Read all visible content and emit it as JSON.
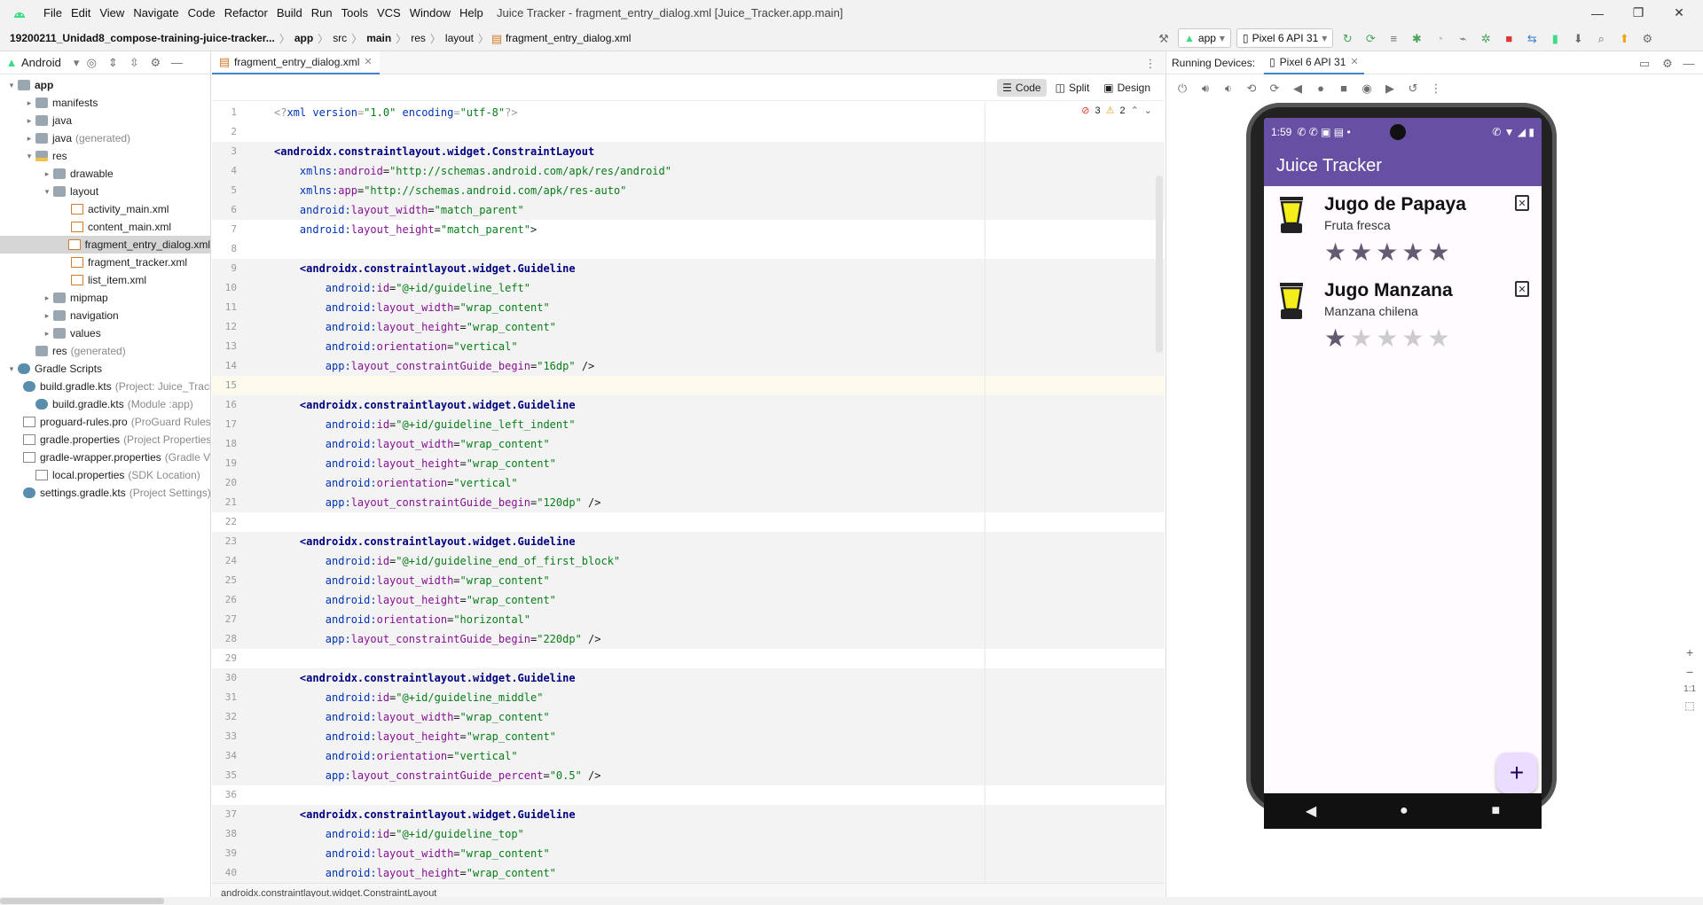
{
  "menu": {
    "items": [
      "File",
      "Edit",
      "View",
      "Navigate",
      "Code",
      "Refactor",
      "Build",
      "Run",
      "Tools",
      "VCS",
      "Window",
      "Help"
    ],
    "window_title": "Juice Tracker - fragment_entry_dialog.xml [Juice_Tracker.app.main]"
  },
  "nav": {
    "project": "19200211_Unidad8_compose-training-juice-tracker...",
    "crumbs": [
      "app",
      "src",
      "main",
      "res",
      "layout"
    ],
    "file": "fragment_entry_dialog.xml",
    "run_config": "app",
    "device": "Pixel 6 API 31"
  },
  "project_panel": {
    "view_mode": "Android",
    "tree": [
      {
        "label": "app",
        "depth": 0,
        "arrow": "▾",
        "icon": "folder",
        "bold": true
      },
      {
        "label": "manifests",
        "depth": 1,
        "arrow": "▸",
        "icon": "folder"
      },
      {
        "label": "java",
        "depth": 1,
        "arrow": "▸",
        "icon": "folder"
      },
      {
        "label": "java",
        "extra": "(generated)",
        "depth": 1,
        "arrow": "▸",
        "icon": "folder"
      },
      {
        "label": "res",
        "depth": 1,
        "arrow": "▾",
        "icon": "resfolder"
      },
      {
        "label": "drawable",
        "depth": 2,
        "arrow": "▸",
        "icon": "folder"
      },
      {
        "label": "layout",
        "depth": 2,
        "arrow": "▾",
        "icon": "folder"
      },
      {
        "label": "activity_main.xml",
        "depth": 3,
        "arrow": "",
        "icon": "xml"
      },
      {
        "label": "content_main.xml",
        "depth": 3,
        "arrow": "",
        "icon": "xml"
      },
      {
        "label": "fragment_entry_dialog.xml",
        "depth": 3,
        "arrow": "",
        "icon": "xml",
        "selected": true
      },
      {
        "label": "fragment_tracker.xml",
        "depth": 3,
        "arrow": "",
        "icon": "xml"
      },
      {
        "label": "list_item.xml",
        "depth": 3,
        "arrow": "",
        "icon": "xml"
      },
      {
        "label": "mipmap",
        "depth": 2,
        "arrow": "▸",
        "icon": "folder"
      },
      {
        "label": "navigation",
        "depth": 2,
        "arrow": "▸",
        "icon": "folder"
      },
      {
        "label": "values",
        "depth": 2,
        "arrow": "▸",
        "icon": "folder"
      },
      {
        "label": "res",
        "extra": "(generated)",
        "depth": 1,
        "arrow": "",
        "icon": "folder"
      },
      {
        "label": "Gradle Scripts",
        "depth": 0,
        "arrow": "▾",
        "icon": "gradle"
      },
      {
        "label": "build.gradle.kts",
        "extra": "(Project: Juice_Tracker)",
        "depth": 1,
        "arrow": "",
        "icon": "gradle"
      },
      {
        "label": "build.gradle.kts",
        "extra": "(Module :app)",
        "depth": 1,
        "arrow": "",
        "icon": "gradle"
      },
      {
        "label": "proguard-rules.pro",
        "extra": "(ProGuard Rules for \":app\")",
        "depth": 1,
        "arrow": "",
        "icon": "prop"
      },
      {
        "label": "gradle.properties",
        "extra": "(Project Properties)",
        "depth": 1,
        "arrow": "",
        "icon": "prop"
      },
      {
        "label": "gradle-wrapper.properties",
        "extra": "(Gradle Version)",
        "depth": 1,
        "arrow": "",
        "icon": "prop"
      },
      {
        "label": "local.properties",
        "extra": "(SDK Location)",
        "depth": 1,
        "arrow": "",
        "icon": "prop"
      },
      {
        "label": "settings.gradle.kts",
        "extra": "(Project Settings)",
        "depth": 1,
        "arrow": "",
        "icon": "gradle"
      }
    ]
  },
  "editor": {
    "tab": "fragment_entry_dialog.xml",
    "modes": [
      "Code",
      "Split",
      "Design"
    ],
    "errors": "3",
    "warnings": "2",
    "status_path": "androidx.constraintlayout.widget.ConstraintLayout",
    "lines": [
      [
        [
          "pi",
          "<?"
        ],
        [
          "ns",
          "xml version"
        ],
        [
          "pi",
          "="
        ],
        [
          "val",
          "\"1.0\""
        ],
        [
          "pi",
          " "
        ],
        [
          "ns",
          "encoding"
        ],
        [
          "pi",
          "="
        ],
        [
          "val",
          "\"utf-8\""
        ],
        [
          "pi",
          "?>"
        ]
      ],
      [],
      [
        [
          "tag",
          "<androidx.constraintlayout.widget.ConstraintLayout"
        ]
      ],
      [
        [
          "pl",
          "    "
        ],
        [
          "ns",
          "xmlns:"
        ],
        [
          "at",
          "android"
        ],
        [
          "pl",
          "="
        ],
        [
          "val",
          "\"http://schemas.android.com/apk/res/android\""
        ]
      ],
      [
        [
          "pl",
          "    "
        ],
        [
          "ns",
          "xmlns:"
        ],
        [
          "at",
          "app"
        ],
        [
          "pl",
          "="
        ],
        [
          "val",
          "\"http://schemas.android.com/apk/res-auto\""
        ]
      ],
      [
        [
          "pl",
          "    "
        ],
        [
          "ns",
          "android:"
        ],
        [
          "at",
          "layout_width"
        ],
        [
          "pl",
          "="
        ],
        [
          "val",
          "\"match_parent\""
        ]
      ],
      [
        [
          "pl",
          "    "
        ],
        [
          "ns",
          "android:"
        ],
        [
          "at",
          "layout_height"
        ],
        [
          "pl",
          "="
        ],
        [
          "val",
          "\"match_parent\""
        ],
        [
          "pl",
          ">"
        ]
      ],
      [],
      [
        [
          "pl",
          "    "
        ],
        [
          "tag",
          "<androidx.constraintlayout.widget.Guideline"
        ]
      ],
      [
        [
          "pl",
          "        "
        ],
        [
          "ns",
          "android:"
        ],
        [
          "at",
          "id"
        ],
        [
          "pl",
          "="
        ],
        [
          "val",
          "\"@+id/guideline_left\""
        ]
      ],
      [
        [
          "pl",
          "        "
        ],
        [
          "ns",
          "android:"
        ],
        [
          "at",
          "layout_width"
        ],
        [
          "pl",
          "="
        ],
        [
          "val",
          "\"wrap_content\""
        ]
      ],
      [
        [
          "pl",
          "        "
        ],
        [
          "ns",
          "android:"
        ],
        [
          "at",
          "layout_height"
        ],
        [
          "pl",
          "="
        ],
        [
          "val",
          "\"wrap_content\""
        ]
      ],
      [
        [
          "pl",
          "        "
        ],
        [
          "ns",
          "android:"
        ],
        [
          "at",
          "orientation"
        ],
        [
          "pl",
          "="
        ],
        [
          "val",
          "\"vertical\""
        ]
      ],
      [
        [
          "pl",
          "        "
        ],
        [
          "ns",
          "app:"
        ],
        [
          "at",
          "layout_constraintGuide_begin"
        ],
        [
          "pl",
          "="
        ],
        [
          "val",
          "\"16dp\""
        ],
        [
          "pl",
          " />"
        ]
      ],
      [],
      [
        [
          "pl",
          "    "
        ],
        [
          "tag",
          "<androidx.constraintlayout.widget.Guideline"
        ]
      ],
      [
        [
          "pl",
          "        "
        ],
        [
          "ns",
          "android:"
        ],
        [
          "at",
          "id"
        ],
        [
          "pl",
          "="
        ],
        [
          "val",
          "\"@+id/guideline_left_indent\""
        ]
      ],
      [
        [
          "pl",
          "        "
        ],
        [
          "ns",
          "android:"
        ],
        [
          "at",
          "layout_width"
        ],
        [
          "pl",
          "="
        ],
        [
          "val",
          "\"wrap_content\""
        ]
      ],
      [
        [
          "pl",
          "        "
        ],
        [
          "ns",
          "android:"
        ],
        [
          "at",
          "layout_height"
        ],
        [
          "pl",
          "="
        ],
        [
          "val",
          "\"wrap_content\""
        ]
      ],
      [
        [
          "pl",
          "        "
        ],
        [
          "ns",
          "android:"
        ],
        [
          "at",
          "orientation"
        ],
        [
          "pl",
          "="
        ],
        [
          "val",
          "\"vertical\""
        ]
      ],
      [
        [
          "pl",
          "        "
        ],
        [
          "ns",
          "app:"
        ],
        [
          "at",
          "layout_constraintGuide_begin"
        ],
        [
          "pl",
          "="
        ],
        [
          "val",
          "\"120dp\""
        ],
        [
          "pl",
          " />"
        ]
      ],
      [],
      [
        [
          "pl",
          "    "
        ],
        [
          "tag",
          "<androidx.constraintlayout.widget.Guideline"
        ]
      ],
      [
        [
          "pl",
          "        "
        ],
        [
          "ns",
          "android:"
        ],
        [
          "at",
          "id"
        ],
        [
          "pl",
          "="
        ],
        [
          "val",
          "\"@+id/guideline_end_of_first_block\""
        ]
      ],
      [
        [
          "pl",
          "        "
        ],
        [
          "ns",
          "android:"
        ],
        [
          "at",
          "layout_width"
        ],
        [
          "pl",
          "="
        ],
        [
          "val",
          "\"wrap_content\""
        ]
      ],
      [
        [
          "pl",
          "        "
        ],
        [
          "ns",
          "android:"
        ],
        [
          "at",
          "layout_height"
        ],
        [
          "pl",
          "="
        ],
        [
          "val",
          "\"wrap_content\""
        ]
      ],
      [
        [
          "pl",
          "        "
        ],
        [
          "ns",
          "android:"
        ],
        [
          "at",
          "orientation"
        ],
        [
          "pl",
          "="
        ],
        [
          "val",
          "\"horizontal\""
        ]
      ],
      [
        [
          "pl",
          "        "
        ],
        [
          "ns",
          "app:"
        ],
        [
          "at",
          "layout_constraintGuide_begin"
        ],
        [
          "pl",
          "="
        ],
        [
          "val",
          "\"220dp\""
        ],
        [
          "pl",
          " />"
        ]
      ],
      [],
      [
        [
          "pl",
          "    "
        ],
        [
          "tag",
          "<androidx.constraintlayout.widget.Guideline"
        ]
      ],
      [
        [
          "pl",
          "        "
        ],
        [
          "ns",
          "android:"
        ],
        [
          "at",
          "id"
        ],
        [
          "pl",
          "="
        ],
        [
          "val",
          "\"@+id/guideline_middle\""
        ]
      ],
      [
        [
          "pl",
          "        "
        ],
        [
          "ns",
          "android:"
        ],
        [
          "at",
          "layout_width"
        ],
        [
          "pl",
          "="
        ],
        [
          "val",
          "\"wrap_content\""
        ]
      ],
      [
        [
          "pl",
          "        "
        ],
        [
          "ns",
          "android:"
        ],
        [
          "at",
          "layout_height"
        ],
        [
          "pl",
          "="
        ],
        [
          "val",
          "\"wrap_content\""
        ]
      ],
      [
        [
          "pl",
          "        "
        ],
        [
          "ns",
          "android:"
        ],
        [
          "at",
          "orientation"
        ],
        [
          "pl",
          "="
        ],
        [
          "val",
          "\"vertical\""
        ]
      ],
      [
        [
          "pl",
          "        "
        ],
        [
          "ns",
          "app:"
        ],
        [
          "at",
          "layout_constraintGuide_percent"
        ],
        [
          "pl",
          "="
        ],
        [
          "val",
          "\"0.5\""
        ],
        [
          "pl",
          " />"
        ]
      ],
      [],
      [
        [
          "pl",
          "    "
        ],
        [
          "tag",
          "<androidx.constraintlayout.widget.Guideline"
        ]
      ],
      [
        [
          "pl",
          "        "
        ],
        [
          "ns",
          "android:"
        ],
        [
          "at",
          "id"
        ],
        [
          "pl",
          "="
        ],
        [
          "val",
          "\"@+id/guideline_top\""
        ]
      ],
      [
        [
          "pl",
          "        "
        ],
        [
          "ns",
          "android:"
        ],
        [
          "at",
          "layout_width"
        ],
        [
          "pl",
          "="
        ],
        [
          "val",
          "\"wrap_content\""
        ]
      ],
      [
        [
          "pl",
          "        "
        ],
        [
          "ns",
          "android:"
        ],
        [
          "at",
          "layout_height"
        ],
        [
          "pl",
          "="
        ],
        [
          "val",
          "\"wrap_content\""
        ]
      ]
    ]
  },
  "devices": {
    "label": "Running Devices:",
    "tab": "Pixel 6 API 31",
    "phone": {
      "time": "1:59",
      "app_title": "Juice Tracker",
      "juices": [
        {
          "name": "Jugo de Papaya",
          "description": "Fruta fresca",
          "rating": 5
        },
        {
          "name": "Jugo Manzana",
          "description": "Manzana chilena",
          "rating": 1
        }
      ],
      "fab": "+"
    },
    "zoom": {
      "in": "+",
      "out": "−",
      "actual": "1:1"
    }
  },
  "colors": {
    "accent": "#6750a4",
    "juice": "#f5ee1b",
    "star_on": "#625b71",
    "star_off": "#cdcbd0"
  }
}
